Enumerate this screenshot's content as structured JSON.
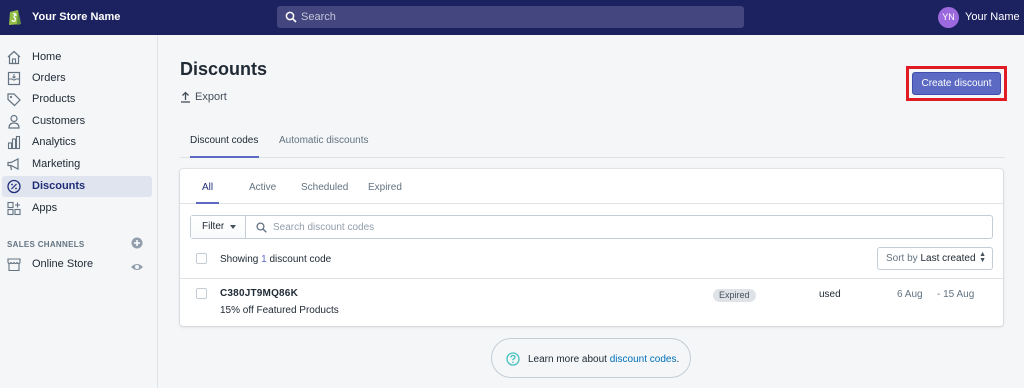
{
  "topbar": {
    "store_name": "Your Store Name",
    "search_placeholder": "Search",
    "avatar_initials": "YN",
    "user_name": "Your Name"
  },
  "sidebar": {
    "items": [
      {
        "label": "Home",
        "icon": "home-icon"
      },
      {
        "label": "Orders",
        "icon": "orders-icon"
      },
      {
        "label": "Products",
        "icon": "tag-icon"
      },
      {
        "label": "Customers",
        "icon": "person-icon"
      },
      {
        "label": "Analytics",
        "icon": "bar-chart-icon"
      },
      {
        "label": "Marketing",
        "icon": "megaphone-icon"
      },
      {
        "label": "Discounts",
        "icon": "discount-icon",
        "active": true
      },
      {
        "label": "Apps",
        "icon": "apps-icon"
      }
    ],
    "channels_title": "SALES CHANNELS",
    "channels": [
      {
        "label": "Online Store",
        "icon": "store-icon"
      }
    ]
  },
  "page": {
    "title": "Discounts",
    "export_label": "Export",
    "create_label": "Create discount",
    "top_tabs": [
      "Discount codes",
      "Automatic discounts"
    ],
    "sub_tabs": [
      "All",
      "Active",
      "Scheduled",
      "Expired"
    ],
    "filter_label": "Filter",
    "search_placeholder": "Search discount codes",
    "showing_prefix": "Showing",
    "showing_count": "1",
    "showing_suffix": "discount code",
    "sort_prefix": "Sort by",
    "sort_value": "Last created",
    "rows": [
      {
        "code": "C380JT9MQ86K",
        "description": "15% off Featured Products",
        "status": "Expired",
        "used": "used",
        "start": "6 Aug",
        "end": "- 15 Aug"
      }
    ],
    "help_text": "Learn more about",
    "help_link": "discount codes",
    "help_period": "."
  },
  "colors": {
    "topbar": "#1c2260",
    "accent": "#5c6ac4",
    "highlight": "#e01b24",
    "link": "#006fbb"
  }
}
